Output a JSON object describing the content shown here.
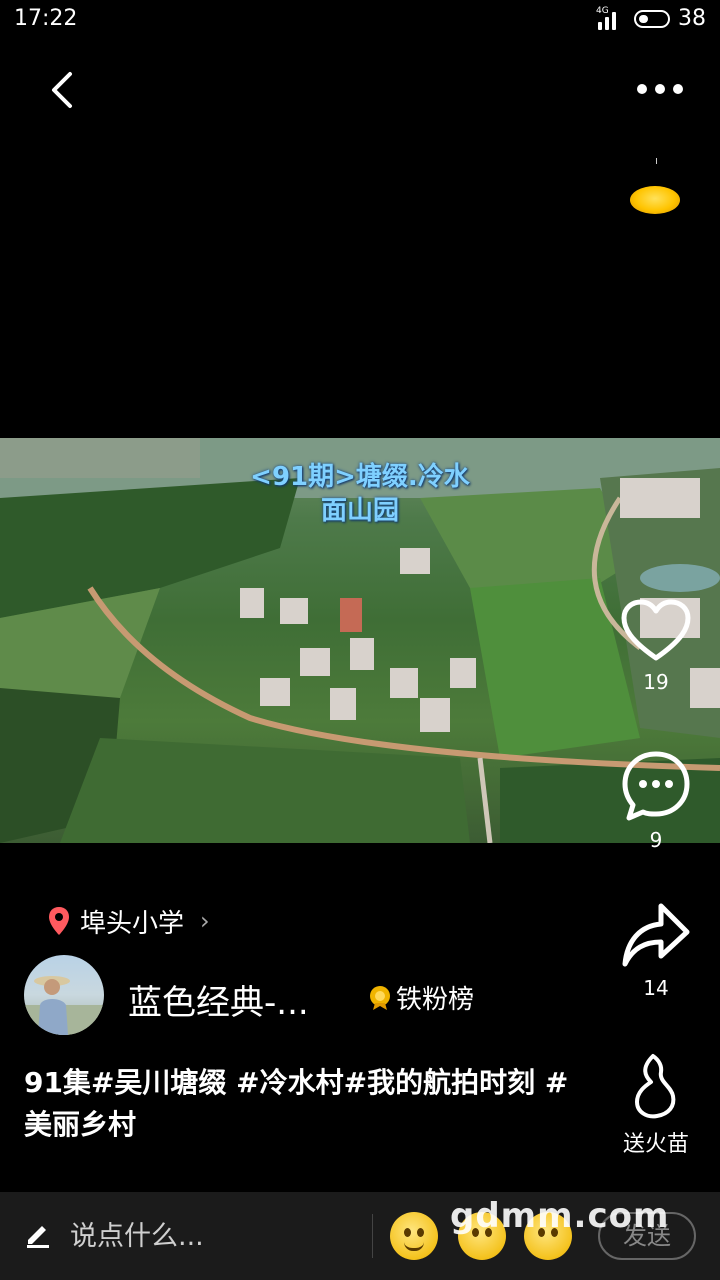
{
  "status_bar": {
    "time": "17:22",
    "network": "4G",
    "battery": "38"
  },
  "top_bar": {
    "back_icon": "chevron-left-icon",
    "more_icon": "more-dots-icon"
  },
  "video": {
    "overlay_title_line1": "<91期>塘缀.冷水",
    "overlay_title_line2": "面山园"
  },
  "actions": {
    "like_count": "19",
    "comment_count": "9",
    "share_count": "14",
    "fire_label": "送火苗"
  },
  "location": {
    "name": "埠头小学"
  },
  "author": {
    "name": "蓝色经典-...",
    "badge": "铁粉榜"
  },
  "caption": "91集#吴川塘缀 #冷水村#我的航拍时刻 #美丽乡村",
  "bottom_bar": {
    "placeholder": "说点什么...",
    "send_label": "发送",
    "watermark": "gdmm.com"
  },
  "colors": {
    "title_blue": "#7fd0ff",
    "location_pin": "#ff5a5f",
    "coin": "#ffc400"
  }
}
